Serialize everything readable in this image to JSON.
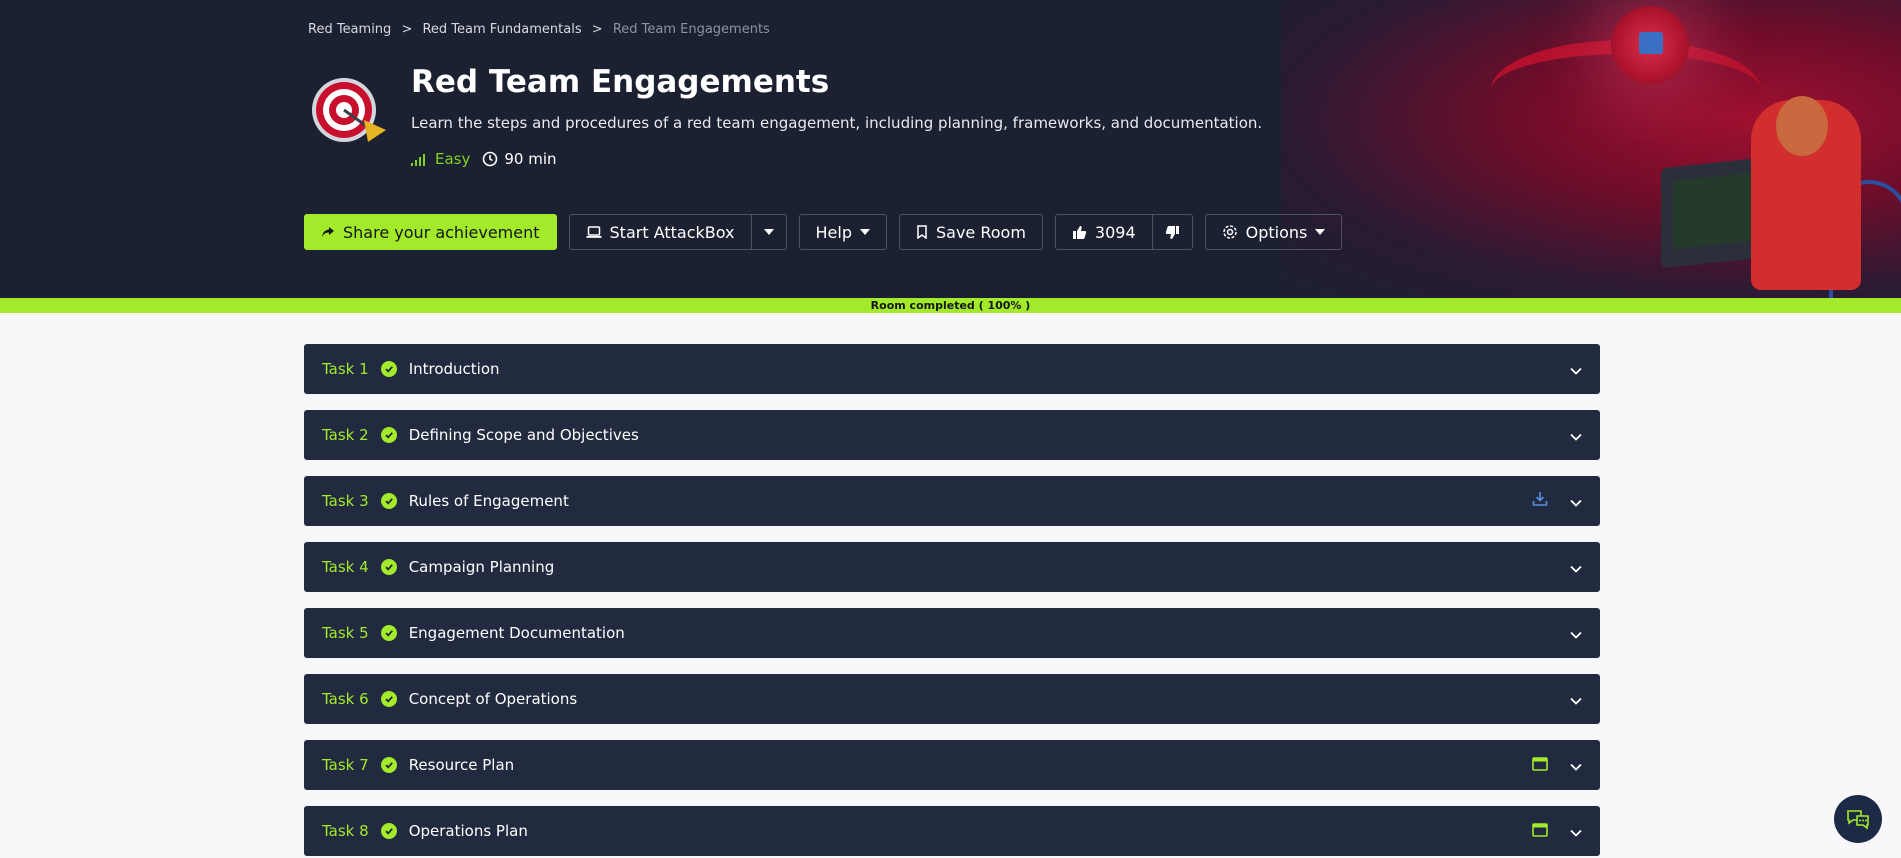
{
  "breadcrumb": {
    "items": [
      "Red Teaming",
      "Red Team Fundamentals"
    ],
    "separator": ">",
    "current": "Red Team Engagements"
  },
  "room": {
    "title": "Red Team Engagements",
    "description": "Learn the steps and procedures of a red team engagement, including planning, frameworks, and documentation.",
    "difficulty": "Easy",
    "duration": "90 min"
  },
  "toolbar": {
    "share_label": "Share your achievement",
    "attackbox_label": "Start AttackBox",
    "help_label": "Help",
    "save_label": "Save Room",
    "likes": "3094",
    "options_label": "Options"
  },
  "progress": {
    "label": "Room completed ( 100% )",
    "value": 1.0
  },
  "tasks": [
    {
      "num": "Task 1",
      "name": "Introduction",
      "extra": ""
    },
    {
      "num": "Task 2",
      "name": "Defining Scope and Objectives",
      "extra": ""
    },
    {
      "num": "Task 3",
      "name": "Rules of Engagement",
      "extra": "download-icon"
    },
    {
      "num": "Task 4",
      "name": "Campaign Planning",
      "extra": ""
    },
    {
      "num": "Task 5",
      "name": "Engagement Documentation",
      "extra": ""
    },
    {
      "num": "Task 6",
      "name": "Concept of Operations",
      "extra": ""
    },
    {
      "num": "Task 7",
      "name": "Resource Plan",
      "extra": "browser-icon"
    },
    {
      "num": "Task 8",
      "name": "Operations Plan",
      "extra": "browser-icon"
    }
  ],
  "colors": {
    "accent": "#a3ea2a",
    "hero_bg": "#1c2131",
    "task_bg": "#212a3f",
    "easy": "#7ed321"
  }
}
